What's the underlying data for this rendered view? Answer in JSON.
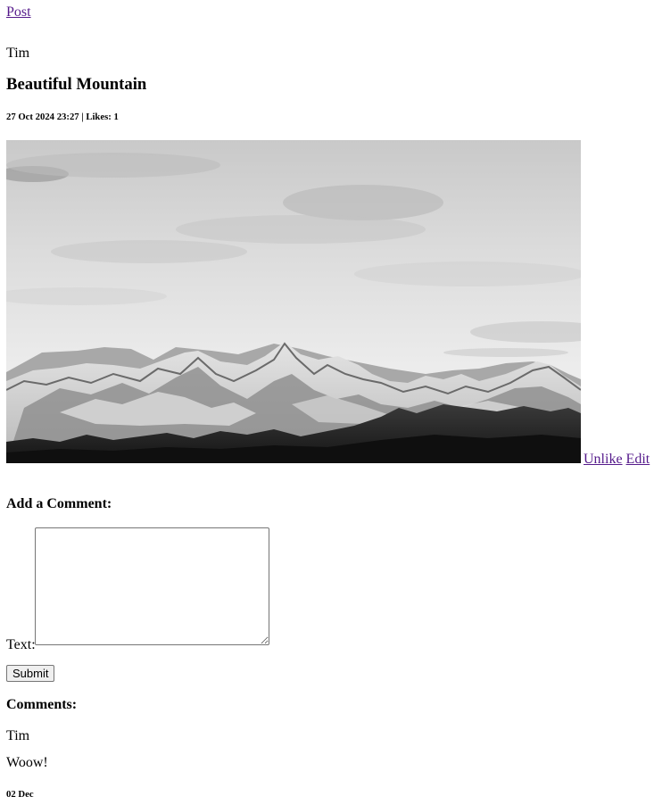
{
  "nav": {
    "post_link": "Post"
  },
  "post": {
    "author": "Tim",
    "title": "Beautiful Mountain",
    "meta": "27 Oct 2024 23:27 | Likes: 1",
    "likes": 1,
    "image_alt": "Black and white mountain range",
    "image_icon": "mountain-photo",
    "actions": {
      "unlike": "Unlike",
      "edit": "Edit"
    }
  },
  "comment_form": {
    "heading": "Add a Comment:",
    "text_label": "Text:",
    "text_value": "",
    "submit_label": "Submit"
  },
  "comments": {
    "heading": "Comments:",
    "items": [
      {
        "author": "Tim",
        "text": "Woow!",
        "date": "02 Dec"
      }
    ]
  },
  "colors": {
    "link": "#551a8b",
    "text": "#000000",
    "background": "#ffffff"
  }
}
